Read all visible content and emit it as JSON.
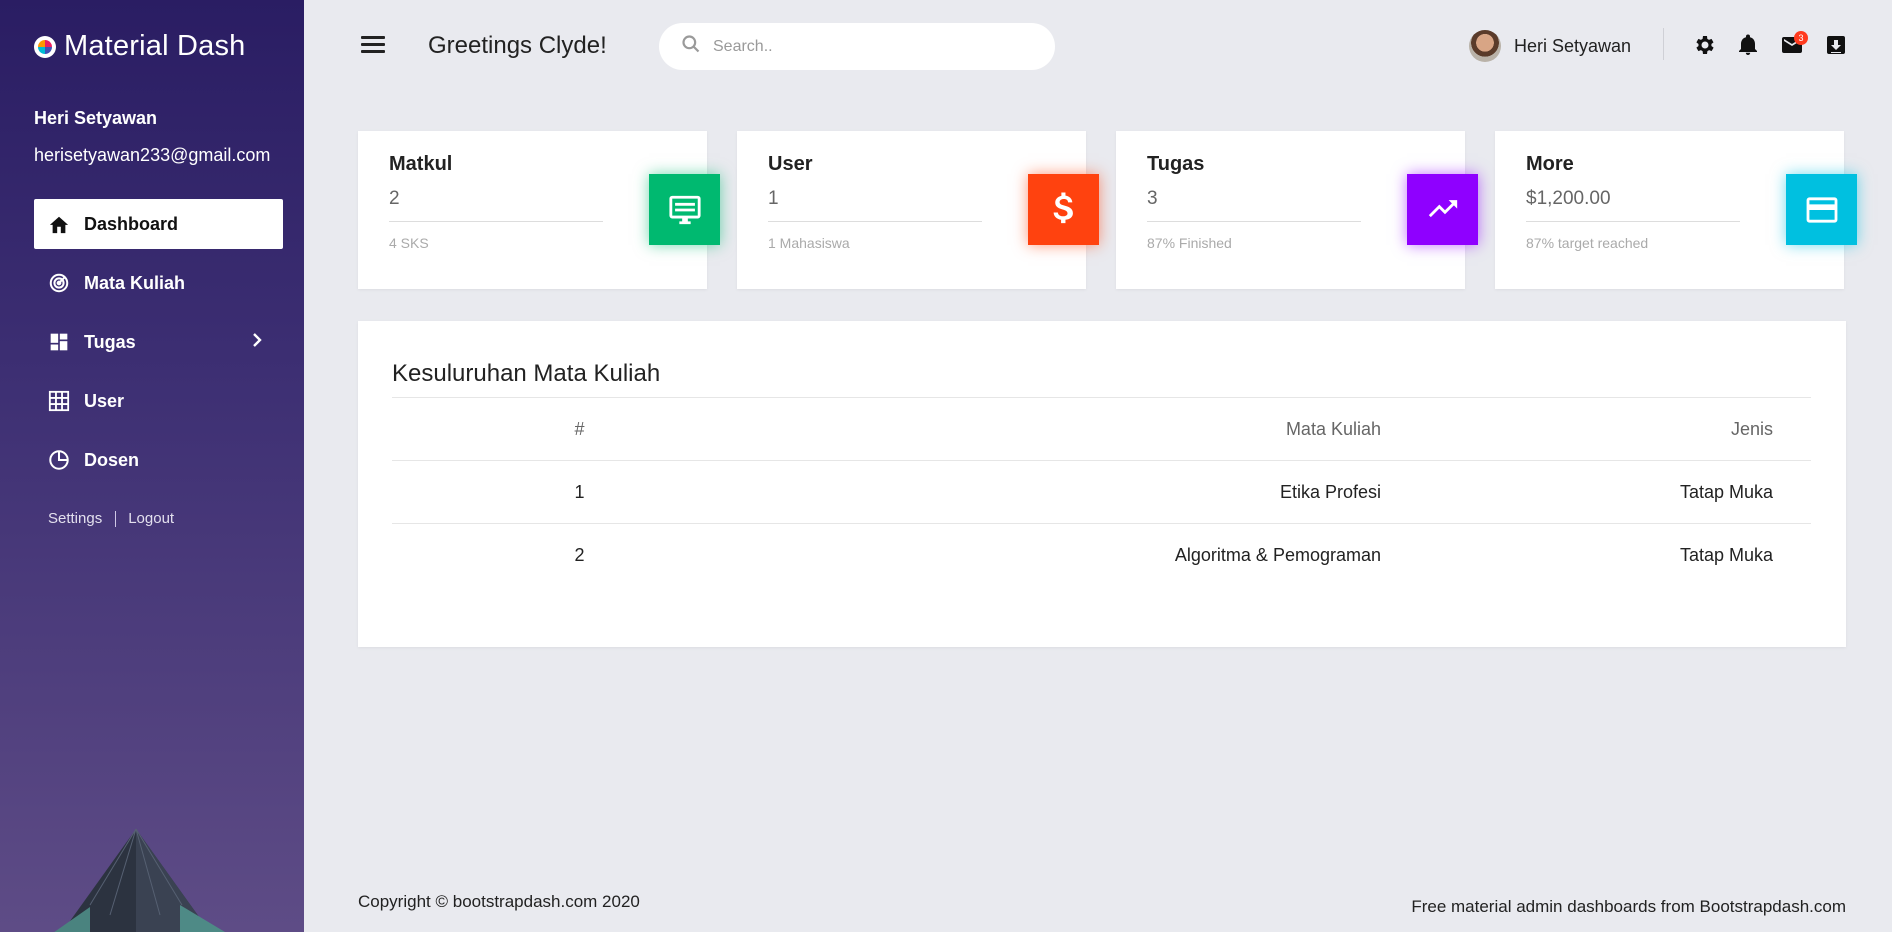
{
  "sidebar": {
    "brand": "Material Dash",
    "profile": {
      "name": "Heri Setyawan",
      "email": "herisetyawan233@gmail.com"
    },
    "items": [
      {
        "label": "Dashboard",
        "icon": "home-icon"
      },
      {
        "label": "Mata Kuliah",
        "icon": "track-changes-icon"
      },
      {
        "label": "Tugas",
        "icon": "dashboard-icon"
      },
      {
        "label": "User",
        "icon": "grid-icon"
      },
      {
        "label": "Dosen",
        "icon": "pie-chart-icon"
      }
    ],
    "links": {
      "settings": "Settings",
      "logout": "Logout"
    }
  },
  "header": {
    "greeting": "Greetings Clyde!",
    "search_placeholder": "Search..",
    "user_name": "Heri Setyawan",
    "mail_badge": "3"
  },
  "cards": [
    {
      "title": "Matkul",
      "value": "2",
      "sub": "4 SKS",
      "icon": "desktop-icon",
      "color": "#00b970"
    },
    {
      "title": "User",
      "value": "1",
      "sub": "1 Mahasiswa",
      "icon": "dollar-icon",
      "color": "#ff420f"
    },
    {
      "title": "Tugas",
      "value": "3",
      "sub": "87% Finished",
      "icon": "trending-up-icon",
      "color": "#8f00ff"
    },
    {
      "title": "More",
      "value": "$1,200.00",
      "sub": "87% target reached",
      "icon": "credit-card-icon",
      "color": "#00c0e0"
    }
  ],
  "table": {
    "title": "Kesuluruhan Mata Kuliah",
    "headers": [
      "#",
      "Mata Kuliah",
      "Jenis"
    ],
    "rows": [
      [
        "1",
        "Etika Profesi",
        "Tatap Muka"
      ],
      [
        "2",
        "Algoritma & Pemograman",
        "Tatap Muka"
      ]
    ]
  },
  "footer": {
    "left_prefix": "Copyright © ",
    "left_link": "bootstrapdash.com",
    "left_suffix": " 2020",
    "right_prefix": "Free ",
    "right_link": "material admin",
    "right_suffix": " dashboards from Bootstrapdash.com"
  }
}
